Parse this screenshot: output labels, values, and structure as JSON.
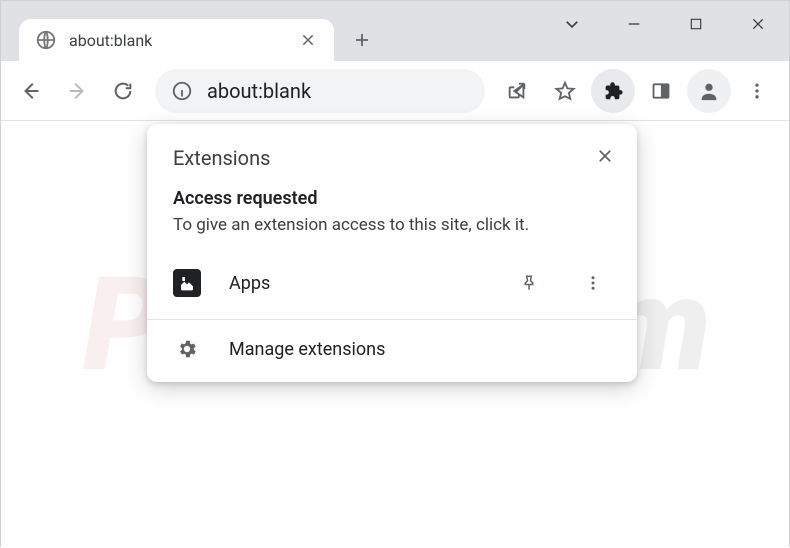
{
  "tab": {
    "title": "about:blank"
  },
  "omnibox": {
    "url": "about:blank"
  },
  "popover": {
    "title": "Extensions",
    "subhead": "Access requested",
    "desc": "To give an extension access to this site, click it.",
    "extension": {
      "name": "Apps"
    },
    "manage_label": "Manage extensions"
  },
  "watermark": {
    "left": "PC",
    "right": "risk.com"
  }
}
